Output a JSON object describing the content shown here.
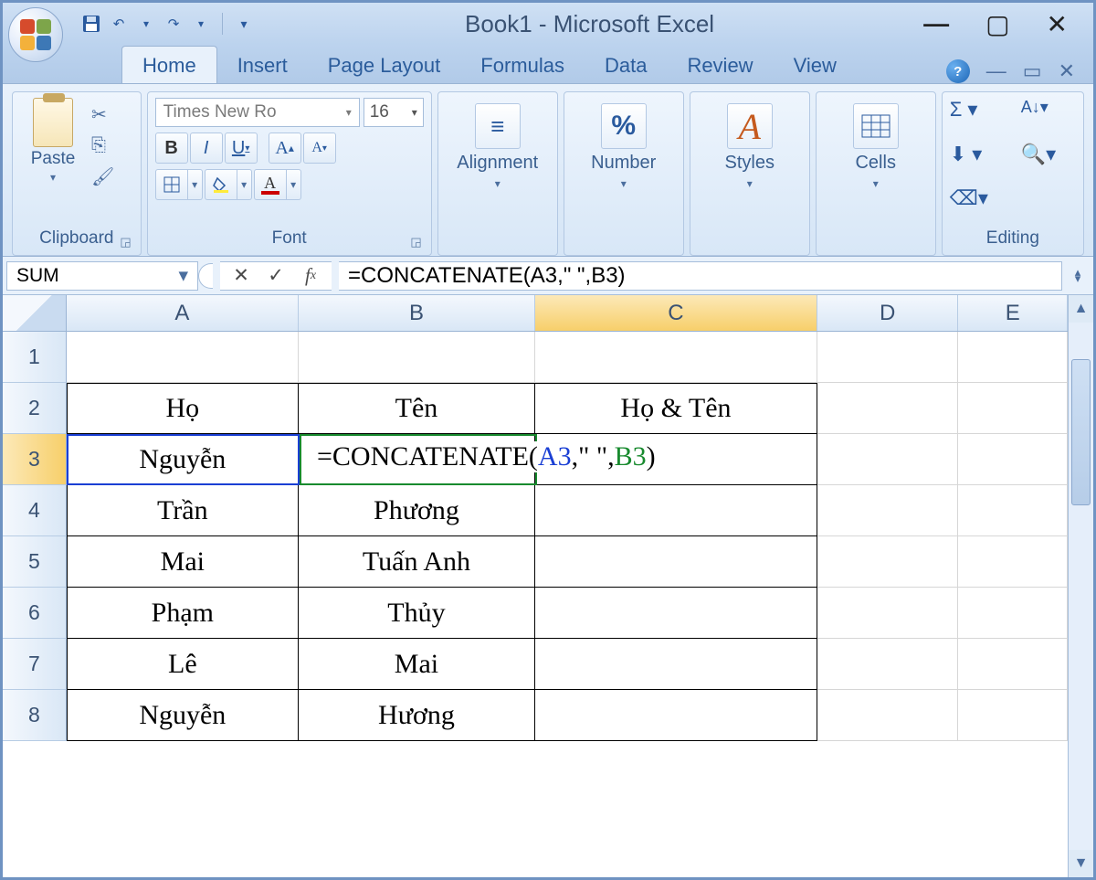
{
  "window": {
    "title": "Book1 - Microsoft Excel"
  },
  "ribbon": {
    "tabs": [
      "Home",
      "Insert",
      "Page Layout",
      "Formulas",
      "Data",
      "Review",
      "View"
    ],
    "active_tab": "Home",
    "clipboard_label": "Clipboard",
    "paste_label": "Paste",
    "font": {
      "label": "Font",
      "name": "Times New Ro",
      "size": "16"
    },
    "alignment_label": "Alignment",
    "number_label": "Number",
    "styles_label": "Styles",
    "cells_label": "Cells",
    "editing_label": "Editing"
  },
  "formula_bar": {
    "name_box": "SUM",
    "formula": "=CONCATENATE(A3,\" \",B3)"
  },
  "columns": [
    "A",
    "B",
    "C",
    "D",
    "E"
  ],
  "rows": [
    {
      "n": "1",
      "A": "",
      "B": "",
      "C": ""
    },
    {
      "n": "2",
      "A": "Họ",
      "B": "Tên",
      "C": "Họ & Tên"
    },
    {
      "n": "3",
      "A": "Nguyễn",
      "B": "",
      "C": ""
    },
    {
      "n": "4",
      "A": "Trần",
      "B": "Phương",
      "C": ""
    },
    {
      "n": "5",
      "A": "Mai",
      "B": "Tuấn Anh",
      "C": ""
    },
    {
      "n": "6",
      "A": "Phạm",
      "B": "Thủy",
      "C": ""
    },
    {
      "n": "7",
      "A": "Lê",
      "B": "Mai",
      "C": ""
    },
    {
      "n": "8",
      "A": "Nguyễn",
      "B": "Hương",
      "C": ""
    }
  ],
  "edit_formula": {
    "prefix": "=CONCATENATE(",
    "ref1": "A3",
    "mid": ",\" \",",
    "ref2": "B3",
    "suffix": ")"
  },
  "active_cell": "C3"
}
